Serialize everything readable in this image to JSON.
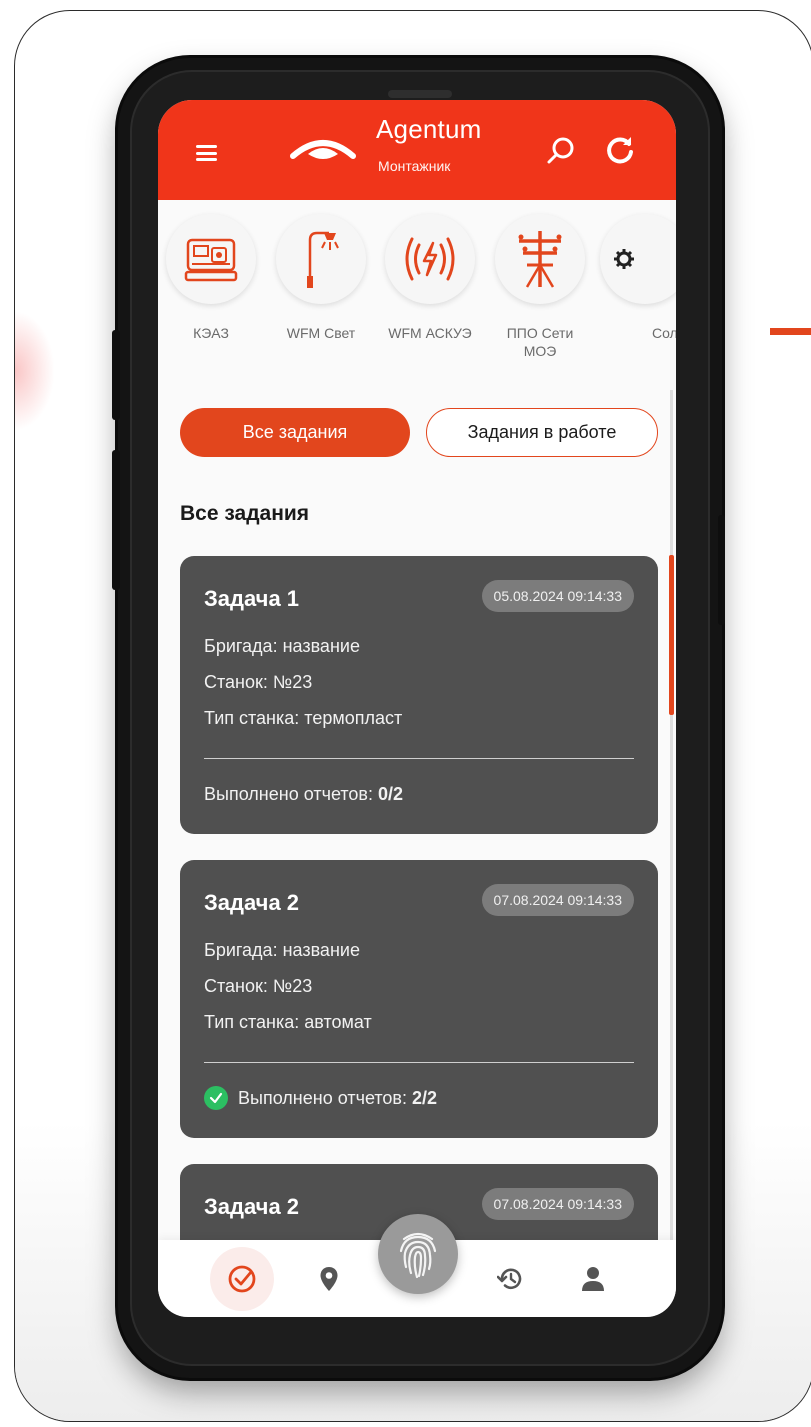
{
  "colors": {
    "header_red": "#f0351a",
    "accent": "#e2461d",
    "card_bg": "#505050",
    "success": "#2cbf62"
  },
  "header": {
    "menu_icon": "hamburger-icon",
    "logo_icon": "eye-logo-icon",
    "title": "Agentum",
    "subtitle": "Монтажник",
    "search_icon": "search-icon",
    "refresh_icon": "refresh-icon"
  },
  "services": [
    {
      "label": "КЭАЗ",
      "icon": "machine-icon"
    },
    {
      "label": "WFM Свет",
      "icon": "street-lamp-icon"
    },
    {
      "label": "WFM АСКУЭ",
      "icon": "energy-signal-icon"
    },
    {
      "label": "ППО Сети\nМОЭ",
      "icon": "power-pole-icon"
    },
    {
      "label": "Сол",
      "icon": "gear-icon"
    }
  ],
  "filters": {
    "all": "Все задания",
    "in_progress": "Задания в работе"
  },
  "section_title": "Все задания",
  "tasks": [
    {
      "title": "Задача 1",
      "date": "05.08.2024 09:14:33",
      "brigade": "Бригада: название",
      "machine": "Станок: №23",
      "machine_type": "Тип станка: термопласт",
      "reports_label": "Выполнено отчетов:",
      "reports_value": "0/2",
      "completed": false
    },
    {
      "title": "Задача 2",
      "date": "07.08.2024 09:14:33",
      "brigade": "Бригада: название",
      "machine": "Станок: №23",
      "machine_type": "Тип станка: автомат",
      "reports_label": "Выполнено отчетов:",
      "reports_value": "2/2",
      "completed": true
    },
    {
      "title": "Задача 2",
      "date": "07.08.2024 09:14:33"
    }
  ],
  "bottom_nav": {
    "items": [
      "tasks-check-icon",
      "location-pin-icon",
      "history-icon",
      "profile-icon"
    ],
    "fab_icon": "fingerprint-icon",
    "active": "tasks-check-icon"
  }
}
